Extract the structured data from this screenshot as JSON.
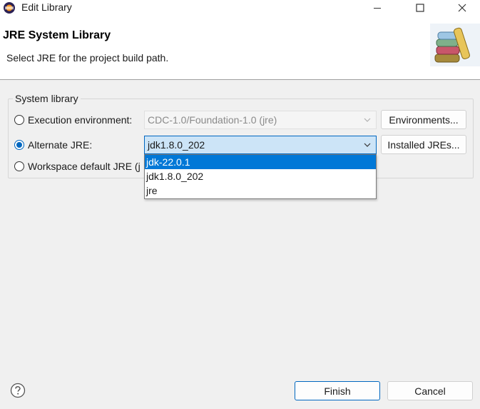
{
  "window": {
    "title": "Edit Library",
    "app_icon": "eclipse-icon",
    "controls": [
      "minimize-icon",
      "maximize-icon",
      "close-icon"
    ]
  },
  "banner": {
    "title": "JRE System Library",
    "description": "Select JRE for the project build path.",
    "graphic": "library-books-icon"
  },
  "group": {
    "label": "System library",
    "options": [
      {
        "label": "Execution environment:",
        "checked": false
      },
      {
        "label": "Alternate JRE:",
        "checked": true
      },
      {
        "label": "Workspace default JRE (j",
        "checked": false
      }
    ],
    "exec_env_combo": {
      "value": "CDC-1.0/Foundation-1.0 (jre)",
      "enabled": false
    },
    "alt_jre_combo": {
      "value": "jdk1.8.0_202",
      "expanded": true
    },
    "environments_button": "Environments...",
    "installed_jres_button": "Installed JREs..."
  },
  "dropdown": {
    "items": [
      "jdk-22.0.1",
      "jdk1.8.0_202",
      "jre"
    ],
    "highlighted": "jdk-22.0.1"
  },
  "footer": {
    "help_icon": "help-icon",
    "finish_label": "Finish",
    "cancel_label": "Cancel"
  },
  "colors": {
    "accent": "#0067c0",
    "selection": "#0078d7",
    "combo_active_bg": "#cce4f7"
  }
}
